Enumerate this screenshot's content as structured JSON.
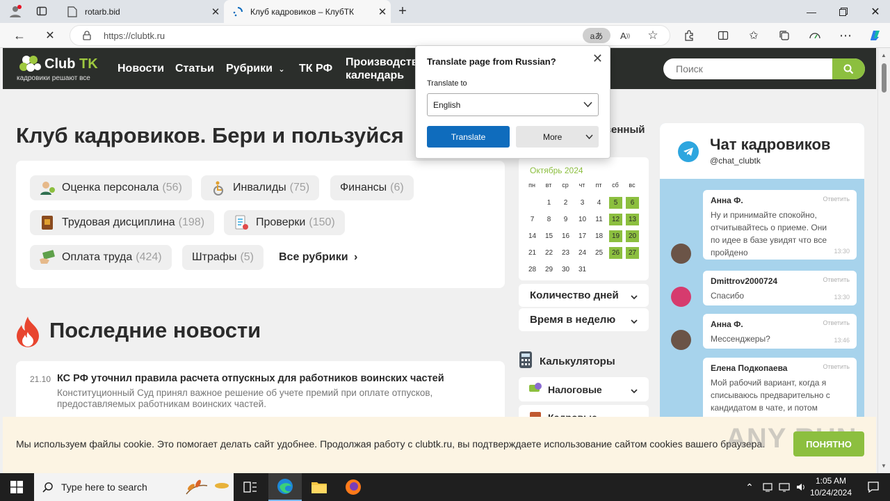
{
  "browser": {
    "tabs": [
      {
        "title": "rotarb.bid"
      },
      {
        "title": "Клуб кадровиков – КлубТК"
      }
    ],
    "url": "https://clubtk.ru",
    "translate_badge": "aあ"
  },
  "site": {
    "logo_name_a": "Club ",
    "logo_name_b": "TK",
    "tagline": "кадровики решают все",
    "nav": [
      "Новости",
      "Статьи",
      "Рубрики",
      "ТК РФ",
      "Производственный календарь"
    ],
    "nav_prod_line1": "Производств",
    "nav_prod_line2": "календарь",
    "search_placeholder": "Поиск"
  },
  "main": {
    "headline": "Клуб кадровиков. Бери и пользуйся",
    "categories": [
      {
        "label": "Оценка персонала",
        "count": "(56)"
      },
      {
        "label": "Инвалиды",
        "count": "(75)"
      },
      {
        "label": "Финансы",
        "count": "(6)"
      },
      {
        "label": "Трудовая дисциплина",
        "count": "(198)"
      },
      {
        "label": "Проверки",
        "count": "(150)"
      },
      {
        "label": "Оплата труда",
        "count": "(424)"
      },
      {
        "label": "Штрафы",
        "count": "(5)"
      }
    ],
    "all_categories": "Все рубрики",
    "news_heading": "Последние новости",
    "news": [
      {
        "date": "21.10",
        "title": "КС РФ уточнил правила расчета отпускных для работников воинских частей",
        "text": "Конституционный Суд принял важное решение об учете премий при оплате отпусков, предоставляемых работникам воинских частей."
      }
    ]
  },
  "calendar": {
    "heading_visible": "венный",
    "month": "Октябрь 2024",
    "weekdays": [
      "пн",
      "вт",
      "ср",
      "чт",
      "пт",
      "сб",
      "вс"
    ],
    "first_weekday_index": 1,
    "days_in_month": 31,
    "weekend_days": [
      5,
      6,
      12,
      13,
      19,
      20,
      26,
      27
    ],
    "acc_days": "Количество дней",
    "acc_time": "Время в неделю",
    "calc_heading": "Калькуляторы",
    "calc_tax": "Налоговые",
    "calc_hr": "Кадровые"
  },
  "chat": {
    "title": "Чат кадровиков",
    "handle": "@chat_clubtk",
    "reply_label": "Ответить",
    "messages": [
      {
        "author": "Анна Ф.",
        "text": "Ну и принимайте спокойно, отчитывайтесь о приеме. Они по идее в базе увидят что все пройдено",
        "time": "13:30"
      },
      {
        "author": "Dmittrov2000724",
        "text": "Спасибо",
        "time": "13:30"
      },
      {
        "author": "Анна Ф.",
        "text": "Мессенджеры?",
        "time": "13:46"
      },
      {
        "author": "Елена Подкопаева",
        "text": "Мой рабочий вариант, когда я списываюсь предварительно с кандидатом в чате, и потом пересылаю ему приглашение",
        "time": ""
      }
    ]
  },
  "cookie": {
    "text": "Мы используем файлы cookie. Это помогает делать сайт удобнее. Продолжая работу с clubtk.ru, вы подтверждаете использование сайтом cookies вашего браузера.",
    "button": "ПОНЯТНО",
    "watermark": "ANY RUN"
  },
  "translate_popup": {
    "title": "Translate page from Russian?",
    "to_label": "Translate to",
    "language": "English",
    "translate_btn": "Translate",
    "more_btn": "More"
  },
  "taskbar": {
    "search_placeholder": "Type here to search",
    "time": "1:05 AM",
    "date": "10/24/2024"
  },
  "colors": {
    "accent_green": "#8cbf3f",
    "header_dark": "#2b2e2b",
    "edge_blue": "#0f6cbd",
    "telegram_blue": "#2ea6df"
  }
}
